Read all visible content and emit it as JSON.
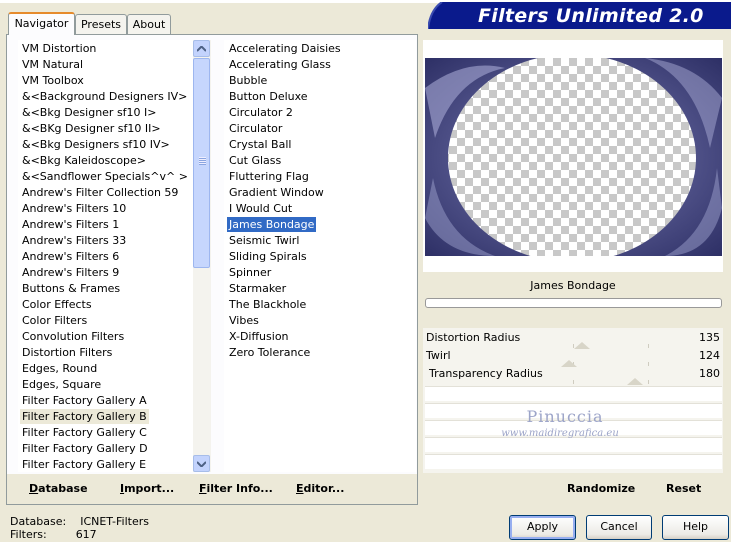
{
  "header": {
    "title": "Filters Unlimited 2.0"
  },
  "tabs": [
    {
      "label": "Navigator",
      "active": true
    },
    {
      "label": "Presets",
      "active": false
    },
    {
      "label": "About",
      "active": false
    }
  ],
  "categories": [
    "VM Distortion",
    "VM Natural",
    "VM Toolbox",
    "&<Background Designers IV>",
    "&<Bkg Designer sf10 I>",
    "&<BKg Designer sf10 II>",
    "&<Bkg Designers sf10 IV>",
    "&<Bkg Kaleidoscope>",
    "&<Sandflower Specials^v^ >",
    "Andrew's Filter Collection 59",
    "Andrew's Filters 10",
    "Andrew's Filters 1",
    "Andrew's Filters 33",
    "Andrew's Filters 6",
    "Andrew's Filters 9",
    "Buttons & Frames",
    "Color Effects",
    "Color Filters",
    "Convolution Filters",
    "Distortion Filters",
    "Edges, Round",
    "Edges, Square",
    "Filter Factory Gallery A",
    "Filter Factory Gallery B",
    "Filter Factory Gallery C",
    "Filter Factory Gallery D",
    "Filter Factory Gallery E"
  ],
  "selected_category_index": 23,
  "filters": [
    "Accelerating Daisies",
    "Accelerating Glass",
    "Bubble",
    "Button Deluxe",
    "Circulator 2",
    "Circulator",
    "Crystal Ball",
    "Cut Glass",
    "Fluttering Flag",
    "Gradient Window",
    "I Would Cut",
    "James Bondage",
    "Seismic Twirl",
    "Sliding Spirals",
    "Spinner",
    "Starmaker",
    "The Blackhole",
    "Vibes",
    "X-Diffusion",
    "Zero Tolerance"
  ],
  "selected_filter_index": 11,
  "panel_buttons": {
    "database": "Database",
    "import": "Import...",
    "filter_info": "Filter Info...",
    "editor": "Editor..."
  },
  "preview": {
    "filter_name": "James Bondage"
  },
  "sliders": [
    {
      "label": "Distortion Radius",
      "value": "135",
      "level": 135
    },
    {
      "label": "Twirl",
      "value": "124",
      "level": 124
    },
    {
      "label": "Transparency Radius",
      "value": "180",
      "level": 180
    }
  ],
  "watermark": {
    "name": "Pinuccia",
    "site": "www.maidiregrafica.eu"
  },
  "right_buttons": {
    "randomize": "Randomize",
    "reset": "Reset"
  },
  "status": {
    "database_label": "Database:",
    "database_value": "ICNET-Filters",
    "filters_label": "Filters:",
    "filters_value": "617"
  },
  "dialog_buttons": {
    "apply": "Apply",
    "cancel": "Cancel",
    "help": "Help"
  },
  "colors": {
    "banner": "#0a1a8c",
    "selection": "#316ac5",
    "tab_accent": "#e68b2c"
  }
}
